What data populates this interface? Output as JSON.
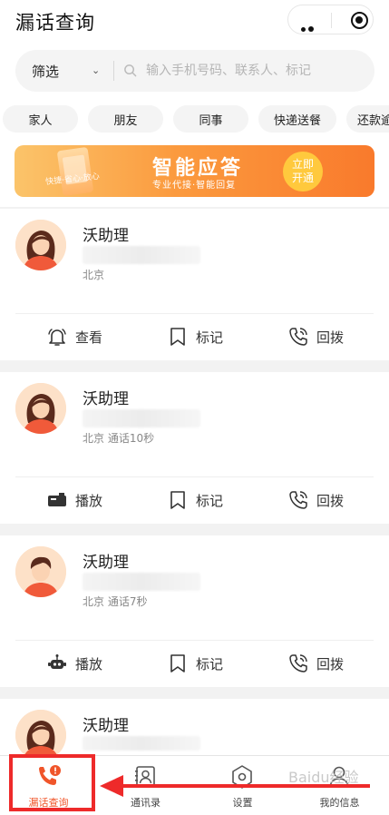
{
  "header": {
    "title": "漏话查询",
    "capsule_more_icon": "more-dots-icon",
    "capsule_close_icon": "target-icon"
  },
  "search": {
    "filter_label": "筛选",
    "placeholder": "输入手机号码、联系人、标记",
    "value": ""
  },
  "tags": [
    "家人",
    "朋友",
    "同事",
    "快递送餐",
    "还款逾"
  ],
  "banner": {
    "headline": "智能应答",
    "subline": "专业代接·智能回复",
    "slogan": "快捷·省心·放心",
    "button_line1": "立即",
    "button_line2": "开通"
  },
  "cards": [
    {
      "name": "沃助理",
      "meta": "北京",
      "avatar": "female-avatar-icon",
      "actions": [
        {
          "label": "查看",
          "icon": "bell-icon"
        },
        {
          "label": "标记",
          "icon": "bookmark-icon"
        },
        {
          "label": "回拨",
          "icon": "phone-callback-icon"
        }
      ]
    },
    {
      "name": "沃助理",
      "meta": "北京 通话10秒",
      "avatar": "female-avatar-icon",
      "actions": [
        {
          "label": "播放",
          "icon": "mailbox-icon"
        },
        {
          "label": "标记",
          "icon": "bookmark-icon"
        },
        {
          "label": "回拨",
          "icon": "phone-callback-icon"
        }
      ]
    },
    {
      "name": "沃助理",
      "meta": "北京 通话7秒",
      "avatar": "male-avatar-icon",
      "actions": [
        {
          "label": "播放",
          "icon": "robot-icon"
        },
        {
          "label": "标记",
          "icon": "bookmark-icon"
        },
        {
          "label": "回拨",
          "icon": "phone-callback-icon"
        }
      ]
    },
    {
      "name": "沃助理",
      "meta": "",
      "avatar": "female-avatar-icon",
      "actions": []
    }
  ],
  "tabbar": {
    "items": [
      {
        "label": "漏话查询",
        "icon": "phone-alert-icon",
        "active": true
      },
      {
        "label": "通讯录",
        "icon": "contacts-icon",
        "active": false
      },
      {
        "label": "设置",
        "icon": "settings-icon",
        "active": false
      },
      {
        "label": "我的信息",
        "icon": "user-icon",
        "active": false
      }
    ]
  },
  "watermark": "Baidu经验",
  "colors": {
    "accent": "#f0552a",
    "banner_start": "#fbc46a",
    "banner_end": "#f97a2c",
    "highlight": "#ee2a2a"
  }
}
